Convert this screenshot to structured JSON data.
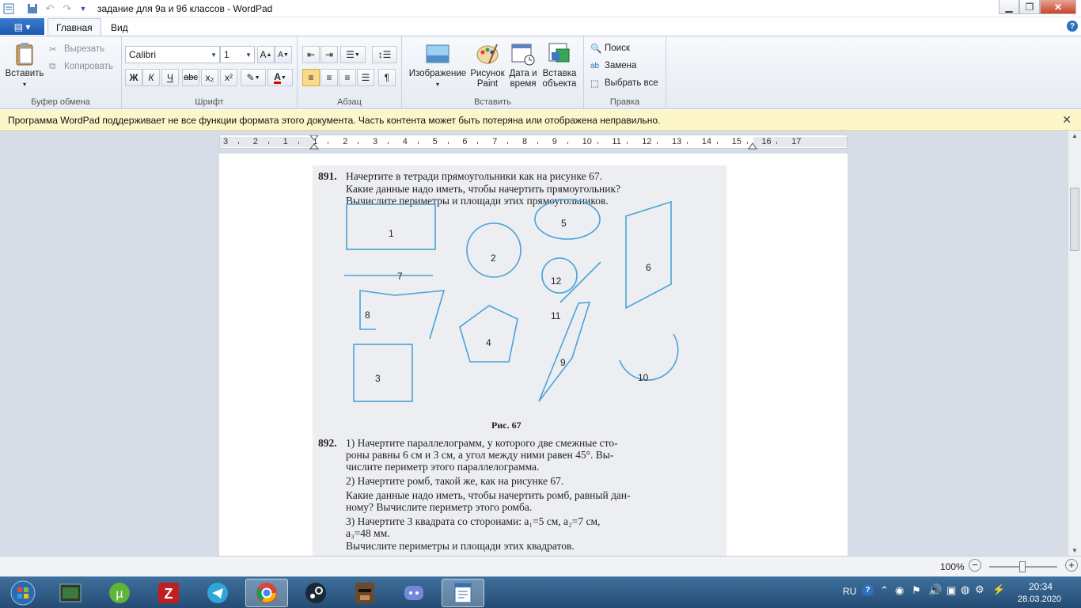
{
  "window": {
    "title": "задание для 9а и 9б классов - WordPad"
  },
  "tabs": {
    "home": "Главная",
    "view": "Вид"
  },
  "ribbon": {
    "clipboard": {
      "paste": "Вставить",
      "cut": "Вырезать",
      "copy": "Копировать",
      "label": "Буфер обмена"
    },
    "font": {
      "name": "Calibri",
      "size": "1",
      "label": "Шрифт",
      "bold": "Ж",
      "italic": "К",
      "underline": "Ч",
      "strike": "abc",
      "sub": "x₂",
      "sup": "x²"
    },
    "paragraph": {
      "label": "Абзац"
    },
    "insert": {
      "image": "Изображение",
      "paint_1": "Рисунок",
      "paint_2": "Paint",
      "datetime_1": "Дата и",
      "datetime_2": "время",
      "object_1": "Вставка",
      "object_2": "объекта",
      "label": "Вставить"
    },
    "edit": {
      "find": "Поиск",
      "replace": "Замена",
      "select_all": "Выбрать все",
      "label": "Правка"
    }
  },
  "infobar": {
    "text": "Программа WordPad поддерживает не все функции формата этого документа. Часть контента может быть потеряна или отображена неправильно."
  },
  "ruler": {
    "labels": [
      "3",
      "2",
      "1",
      "1",
      "2",
      "3",
      "4",
      "5",
      "6",
      "7",
      "8",
      "9",
      "10",
      "11",
      "12",
      "13",
      "14",
      "15",
      "16",
      "17"
    ]
  },
  "document": {
    "p891_num": "891.",
    "p891_l1": "Начертите в тетради прямоугольники как на рисунке 67.",
    "p891_l2": "Какие данные надо иметь, чтобы начертить прямоугольник?",
    "p891_l3": "Вычислите периметры и площади этих прямоугольников.",
    "figure_caption": "Рис. 67",
    "figure_labels": [
      "1",
      "2",
      "3",
      "4",
      "5",
      "6",
      "7",
      "8",
      "9",
      "10",
      "11",
      "12"
    ],
    "p892_num": "892.",
    "p892_l1": "1) Начертите параллелограмм, у которого две смежные сто-",
    "p892_l2": "роны равны 6 см и 3 см, а угол между ними равен 45°. Вы-",
    "p892_l3": "числите периметр этого параллелограмма.",
    "p892_l4": "2) Начертите ромб, такой же, как на рисунке 67.",
    "p892_l5": "Какие данные надо иметь, чтобы начертить ромб, равный дан-",
    "p892_l6": "ному? Вычислите периметр этого ромба.",
    "p892_l7": "3) Начертите 3 квадрата со сторонами: a₁=5 см, a₂=7 см,",
    "p892_l8": "a₃=48 мм.",
    "p892_l9": "Вычислите периметры и площади этих квадратов."
  },
  "status": {
    "zoom": "100%"
  },
  "taskbar": {
    "apps": [
      "start-orb",
      "cmd-icon",
      "utorrent-icon",
      "filezilla-icon",
      "telegram-icon",
      "chrome-icon",
      "steam-icon",
      "game-icon",
      "discord-icon",
      "wordpad-icon"
    ],
    "lang": "RU",
    "time": "20:34",
    "date": "28.03.2020"
  },
  "colors": {
    "accent": "#2f6fc4",
    "figure_stroke": "#4aa3d8",
    "infobar_bg": "#fdf6c9"
  }
}
